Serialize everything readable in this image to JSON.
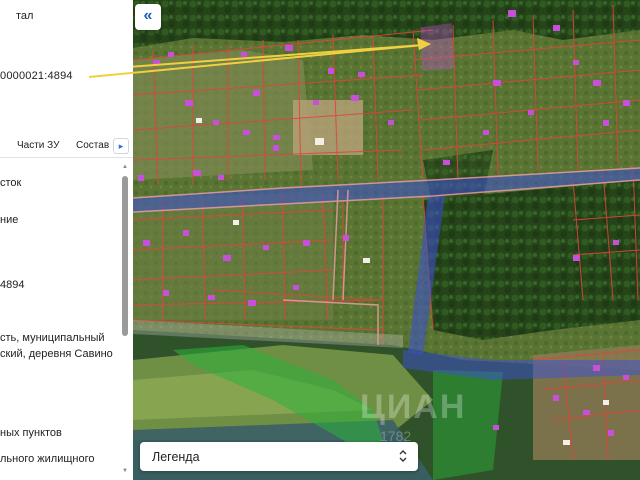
{
  "panel": {
    "title": "тал",
    "cadastral_number": "0000021:4894",
    "tabs": [
      {
        "label": "Части ЗУ"
      },
      {
        "label": "Состав"
      }
    ],
    "next_tab_icon": "chevron-right-icon",
    "fields": [
      "сток",
      "ние",
      "4894",
      "сть, муниципальный",
      "ский, деревня Савино",
      "ных пунктов",
      "льного жилищного"
    ]
  },
  "map": {
    "collapse_icon": "double-chevron-left-icon",
    "legend_label": "Легенда",
    "legend_icon": "updown-chevron-icon",
    "watermark": "ЦИАН",
    "watermark_sub": "1782"
  },
  "colors": {
    "parcel_border": "#e0453a",
    "building": "#c74fd9",
    "road_overlay": "#3c4fd6",
    "highlight": "#f0d040",
    "accent": "#1b5fb8"
  }
}
